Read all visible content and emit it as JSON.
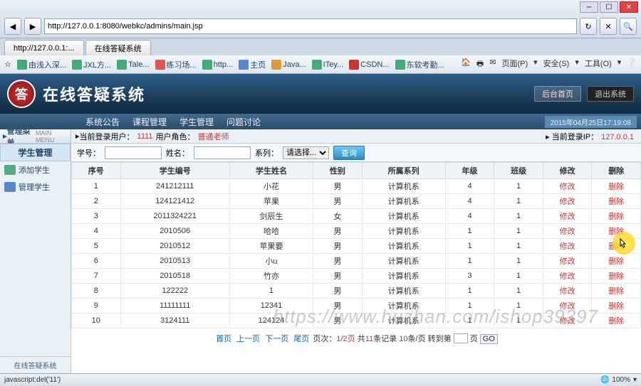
{
  "browser": {
    "url": "http://127.0.0.1:8080/webkc/admins/main.jsp",
    "tab1": "http://127.0.0.1:...",
    "tab2": "在线答疑系统",
    "bookmarks": [
      "由浅入深...",
      "JXL方...",
      "Tale...",
      "练习场...",
      "http...",
      "主页",
      "Java...",
      "ITey...",
      "CSDN...",
      "东软考勤..."
    ],
    "right_menu": [
      "页面(P)",
      "安全(S)",
      "工具(O)"
    ]
  },
  "app": {
    "logo_char": "答",
    "title": "在线答疑系统",
    "hdr_btn1": "后台首页",
    "hdr_btn2": "退出系统",
    "menu": [
      "系统公告",
      "课程管理",
      "学生管理",
      "问题讨论"
    ],
    "datetime": "2015年04月25日17:19:08"
  },
  "sidebar": {
    "header": "管理菜单",
    "header_sub": "MAIN MENU",
    "section": "学生管理",
    "items": [
      "添加学生",
      "管理学生"
    ],
    "footer": "在线答疑系统"
  },
  "infobar": {
    "label_user": "当前登录用户：",
    "user": "1111",
    "label_role": "用户角色：",
    "role": "普通老师",
    "label_ip": "当前登录IP：",
    "ip": "127.0.0.1"
  },
  "search": {
    "lbl_xh": "学号：",
    "lbl_xm": "姓名：",
    "lbl_xl": "系列：",
    "select_default": "请选择...",
    "btn": "查询"
  },
  "table": {
    "headers": [
      "序号",
      "学生编号",
      "学生姓名",
      "性别",
      "所属系列",
      "年级",
      "班级",
      "修改",
      "删除"
    ],
    "action_edit": "修改",
    "action_del": "删除",
    "rows": [
      {
        "n": "1",
        "id": "241212111",
        "name": "小花",
        "sex": "男",
        "dept": "计算机系",
        "grade": "4",
        "cls": "1"
      },
      {
        "n": "2",
        "id": "124121412",
        "name": "苹果",
        "sex": "男",
        "dept": "计算机系",
        "grade": "4",
        "cls": "1"
      },
      {
        "n": "3",
        "id": "2011324221",
        "name": "剑辰生",
        "sex": "女",
        "dept": "计算机系",
        "grade": "4",
        "cls": "1"
      },
      {
        "n": "4",
        "id": "2010506",
        "name": "哈哈",
        "sex": "男",
        "dept": "计算机系",
        "grade": "1",
        "cls": "1"
      },
      {
        "n": "5",
        "id": "2010512",
        "name": "苹果要",
        "sex": "男",
        "dept": "计算机系",
        "grade": "1",
        "cls": "1"
      },
      {
        "n": "6",
        "id": "2010513",
        "name": "小u",
        "sex": "男",
        "dept": "计算机系",
        "grade": "1",
        "cls": "1"
      },
      {
        "n": "7",
        "id": "2010518",
        "name": "竹亦",
        "sex": "男",
        "dept": "计算机系",
        "grade": "3",
        "cls": "1"
      },
      {
        "n": "8",
        "id": "122222",
        "name": "1",
        "sex": "男",
        "dept": "计算机系",
        "grade": "1",
        "cls": "1"
      },
      {
        "n": "9",
        "id": "11111111",
        "name": "12341",
        "sex": "男",
        "dept": "计算机系",
        "grade": "1",
        "cls": "1"
      },
      {
        "n": "10",
        "id": "3124111",
        "name": "124124",
        "sex": "男",
        "dept": "计算机系",
        "grade": "1",
        "cls": "1"
      }
    ]
  },
  "pager": {
    "first": "首页",
    "prev": "上一页",
    "next": "下一页",
    "last": "尾页",
    "pos_label": "页次：",
    "pos": "1/2页",
    "total_label": "共",
    "total": "11",
    "total_unit": "条记录",
    "per": "10",
    "per_unit": "条/页",
    "jump_label": "转到第",
    "jump_unit": "页",
    "go": "GO"
  },
  "watermark": "https://www.huzhan.com/ishop39397",
  "status": {
    "left": "javascript:del('11')",
    "zoom": "100%"
  }
}
